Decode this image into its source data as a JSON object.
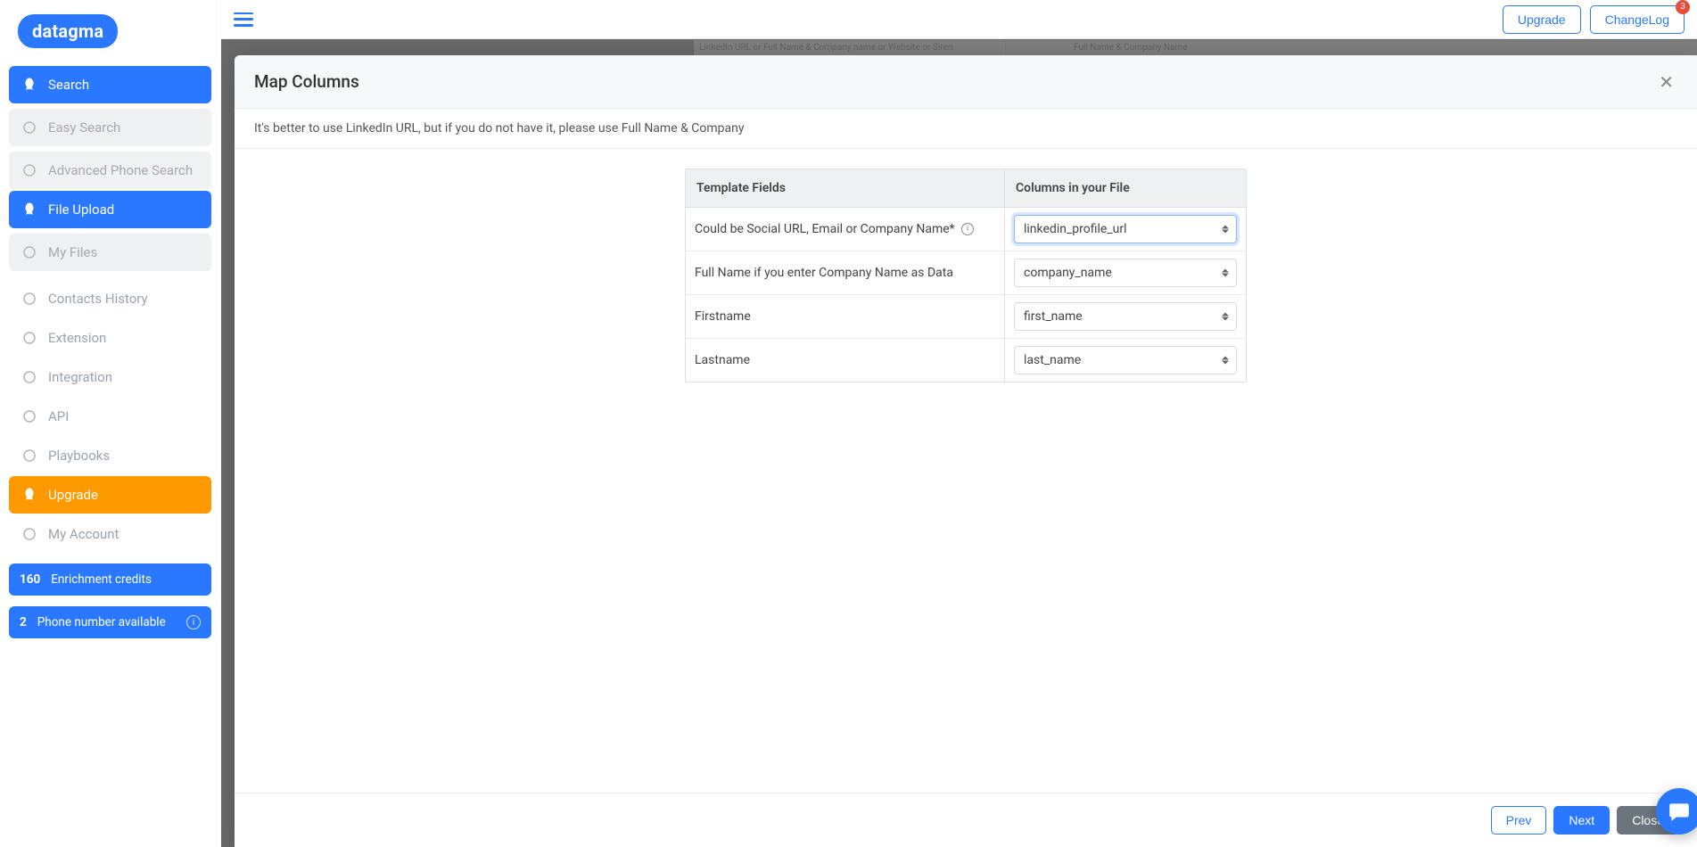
{
  "brand": "datagma",
  "topbar": {
    "upgrade": "Upgrade",
    "changelog": "ChangeLog",
    "changelog_badge": "3"
  },
  "sidebar": {
    "items": [
      {
        "label": "Search",
        "key": "search",
        "active": true,
        "type": "item"
      },
      {
        "label": "Easy Search",
        "key": "easy-search",
        "type": "sub"
      },
      {
        "label": "Advanced Phone Search",
        "key": "adv-phone",
        "type": "sub"
      },
      {
        "label": "File Upload",
        "key": "file-upload",
        "active": true,
        "type": "item"
      },
      {
        "label": "My Files",
        "key": "my-files",
        "type": "sub"
      },
      {
        "label": "Contacts History",
        "key": "contacts-history",
        "type": "item"
      },
      {
        "label": "Extension",
        "key": "extension",
        "type": "item"
      },
      {
        "label": "Integration",
        "key": "integration",
        "type": "item"
      },
      {
        "label": "API",
        "key": "api",
        "type": "item"
      },
      {
        "label": "Playbooks",
        "key": "playbooks",
        "type": "item"
      },
      {
        "label": "Upgrade",
        "key": "upgrade",
        "type": "upgrade"
      },
      {
        "label": "My Account",
        "key": "my-account",
        "type": "item"
      }
    ],
    "credits": {
      "count": "160",
      "label": "Enrichment credits"
    },
    "phone": {
      "count": "2",
      "label": "Phone number available"
    }
  },
  "bg_columns": {
    "c1": "LinkedIn URL or Full Name & Company name or Website or Siren",
    "c2": "Full Name & Company Name"
  },
  "modal": {
    "title": "Map Columns",
    "hint": "It's better to use LinkedIn URL, but if you do not have it, please use Full Name & Company",
    "th1": "Template Fields",
    "th2": "Columns in your File",
    "rows": [
      {
        "field": "Could be Social URL, Email or Company Name*",
        "value": "linkedin_profile_url",
        "info": true,
        "focused": true
      },
      {
        "field": "Full Name if you enter Company Name as Data",
        "value": "company_name"
      },
      {
        "field": "Firstname",
        "value": "first_name"
      },
      {
        "field": "Lastname",
        "value": "last_name"
      }
    ],
    "footer": {
      "prev": "Prev",
      "next": "Next",
      "close": "Close"
    }
  }
}
